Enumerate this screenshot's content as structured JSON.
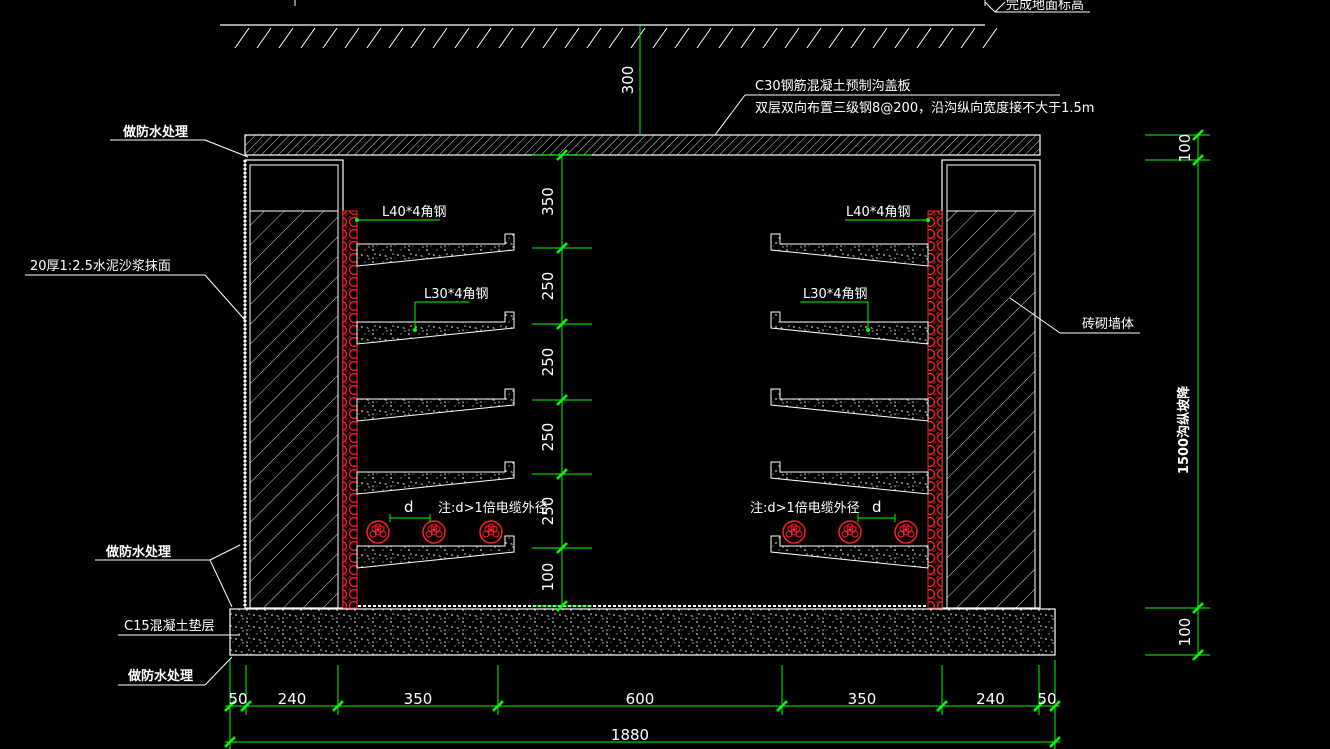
{
  "top_label": "完成地面标高",
  "cover_slab": {
    "line1": "C30钢筋混凝土预制沟盖板",
    "line2": "双层双向布置三级钢8@200，沿沟纵向宽度接不大于1.5m",
    "depth": "300"
  },
  "left_callouts": {
    "waterproof_top": "做防水处理",
    "plaster": "20厚1:2.5水泥沙浆抹面",
    "waterproof_mid": "做防水处理",
    "cushion": "C15混凝土垫层",
    "waterproof_bottom": "做防水处理"
  },
  "right_callouts": {
    "masonry": "砖砌墙体",
    "slope": "1500沟纵坡降"
  },
  "angle_labels": {
    "left_top": "L40*4角钢",
    "right_top": "L40*4角钢",
    "left_mid": "L30*4角钢",
    "right_mid": "L30*4角钢"
  },
  "cable_notes": {
    "left_d": "d",
    "left_note": "注:d>1倍电缆外径",
    "right_d": "d",
    "right_note": "注:d>1倍电缆外径"
  },
  "vertical_dims": [
    "350",
    "250",
    "250",
    "250",
    "250",
    "100"
  ],
  "right_dims": {
    "top": "100",
    "bottom": "100"
  },
  "bottom_dims": [
    "50",
    "240",
    "350",
    "600",
    "350",
    "240",
    "50"
  ],
  "total_width": "1880",
  "colors": {
    "line": "#ffffff",
    "dimension": "#00ff00",
    "rack": "#ff2020",
    "cable": "#ff2020",
    "background": "#000000"
  }
}
